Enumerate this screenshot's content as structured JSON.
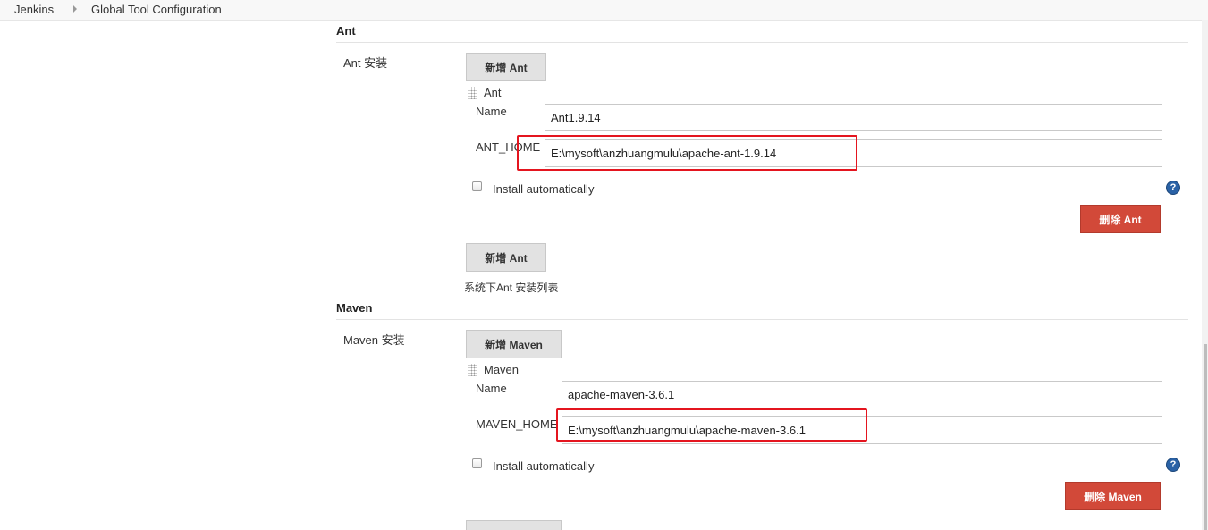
{
  "breadcrumb": {
    "items": [
      {
        "label": "Jenkins"
      },
      {
        "label": "Global Tool Configuration"
      }
    ]
  },
  "ant": {
    "section_title": "Ant",
    "installations_label": "Ant 安装",
    "add_button_label": "新增 Ant",
    "installer_header": "Ant",
    "name_label": "Name",
    "name_value": "Ant1.9.14",
    "home_label": "ANT_HOME",
    "home_value": "E:\\mysoft\\anzhuangmulu\\apache-ant-1.9.14",
    "install_auto_label": "Install automatically",
    "delete_button_label": "删除 Ant",
    "add_button_label_2": "新增 Ant",
    "list_description": "系统下Ant 安装列表"
  },
  "maven": {
    "section_title": "Maven",
    "installations_label": "Maven 安装",
    "add_button_label": "新增 Maven",
    "installer_header": "Maven",
    "name_label": "Name",
    "name_value": "apache-maven-3.6.1",
    "home_label": "MAVEN_HOME",
    "home_value": "E:\\mysoft\\anzhuangmulu\\apache-maven-3.6.1",
    "install_auto_label": "Install automatically",
    "delete_button_label": "删除 Maven"
  },
  "help_glyph": "?",
  "colors": {
    "danger": "#d24939",
    "highlight": "#e4151f",
    "help": "#2a62a6"
  },
  "icons": {
    "breadcrumb_separator": "chevron-right-icon",
    "drag_handle": "drag-handle-icon",
    "help": "help-icon"
  }
}
